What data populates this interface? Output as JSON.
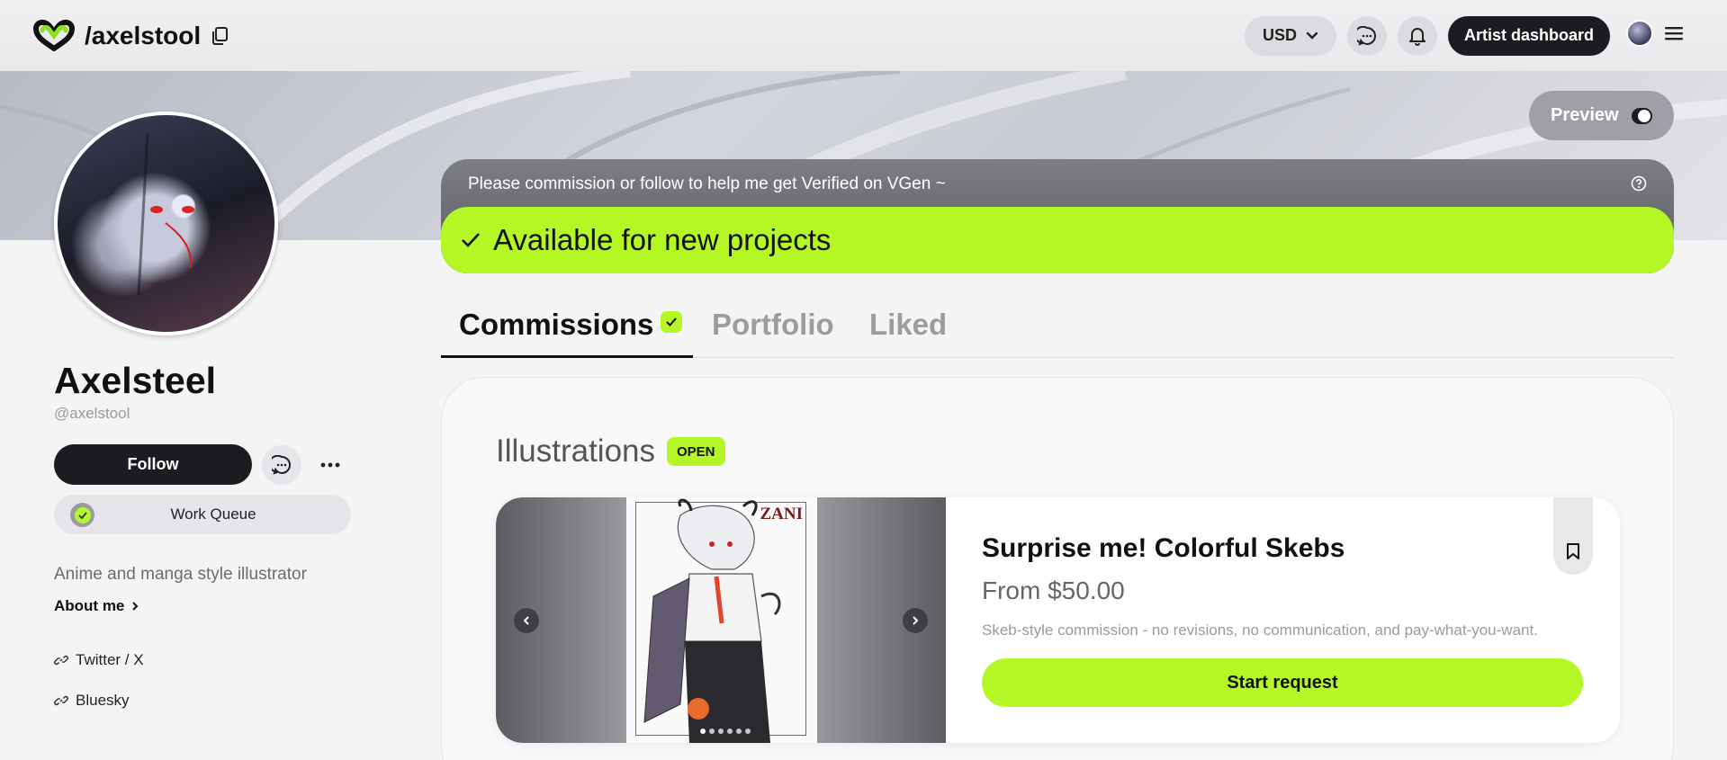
{
  "header": {
    "handle_title": "/axelstool",
    "currency": "USD",
    "dashboard_label": "Artist dashboard"
  },
  "banner": {
    "preview_label": "Preview"
  },
  "profile": {
    "name": "Axelsteel",
    "username": "@axelstool",
    "follow_label": "Follow",
    "work_queue_label": "Work Queue",
    "bio": "Anime and manga style illustrator",
    "about_label": "About me",
    "links": [
      "Twitter / X",
      "Bluesky"
    ]
  },
  "notice": {
    "text": "Please commission or follow to help me get Verified on VGen ~",
    "availability": "Available for new projects"
  },
  "tabs": [
    "Commissions",
    "Portfolio",
    "Liked"
  ],
  "section": {
    "title": "Illustrations",
    "badge": "OPEN"
  },
  "product": {
    "art_label": "ZANI",
    "title": "Surprise me! Colorful Skebs",
    "price": "From $50.00",
    "description": "Skeb-style commission - no revisions, no communication, and pay-what-you-want.",
    "cta": "Start request",
    "carousel_index": 1,
    "carousel_count": 6
  },
  "colors": {
    "accent": "#b4f724",
    "dark": "#1b1c20"
  }
}
